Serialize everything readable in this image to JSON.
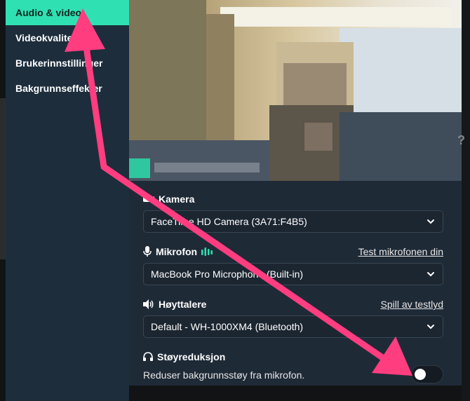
{
  "sidebar": {
    "items": [
      {
        "label": "Audio & video",
        "active": true
      },
      {
        "label": "Videokvalitet",
        "active": false
      },
      {
        "label": "Brukerinnstillinger",
        "active": false
      },
      {
        "label": "Bakgrunnseffekter",
        "active": false
      }
    ]
  },
  "settings": {
    "camera": {
      "label": "Kamera",
      "icon": "camera-icon",
      "value": "FaceTime HD Camera (3A71:F4B5)"
    },
    "microphone": {
      "label": "Mikrofon",
      "icon": "microphone-icon",
      "link": "Test mikrofonen din",
      "value": "MacBook Pro Microphone (Built-in)"
    },
    "speakers": {
      "label": "Høyttalere",
      "icon": "speaker-icon",
      "link": "Spill av testlyd",
      "value": "Default - WH-1000XM4 (Bluetooth)"
    },
    "noise_reduction": {
      "label": "Støyreduksjon",
      "icon": "headphones-icon",
      "description": "Reduser bakgrunnsstøy fra mikrofon.",
      "enabled": false
    }
  },
  "colors": {
    "accent": "#2fe0b3",
    "sidebar_bg": "#1d2d3c",
    "panel_bg": "#1f2a37",
    "annotation_arrow": "#ff3d7f"
  }
}
